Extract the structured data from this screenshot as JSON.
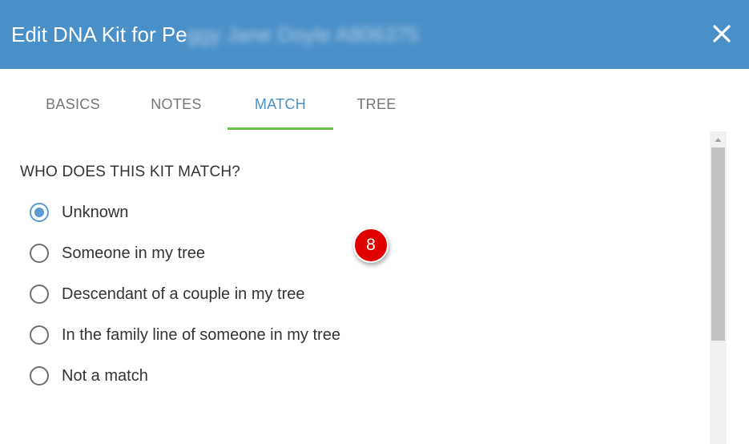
{
  "dialog": {
    "title_prefix": "Edit DNA Kit for Pe",
    "title_obscured": "ggy Jane Doyle A806375",
    "close_icon": "close-icon"
  },
  "tabs": [
    {
      "label": "BASICS",
      "active": false
    },
    {
      "label": "NOTES",
      "active": false
    },
    {
      "label": "MATCH",
      "active": true
    },
    {
      "label": "TREE",
      "active": false
    }
  ],
  "match_section": {
    "heading": "WHO DOES THIS KIT MATCH?",
    "selected": "Unknown",
    "options": [
      {
        "label": "Unknown"
      },
      {
        "label": "Someone in my tree"
      },
      {
        "label": "Descendant of a couple in my tree"
      },
      {
        "label": "In the family line of someone in my tree"
      },
      {
        "label": "Not a match"
      }
    ]
  },
  "annotation": {
    "step_number": "8"
  },
  "colors": {
    "header_bg": "#4a90c8",
    "active_tab_text": "#4a90c8",
    "tab_underline": "#6abf4b",
    "radio_selected": "#5b9ad2",
    "badge_bg": "#e00000"
  }
}
